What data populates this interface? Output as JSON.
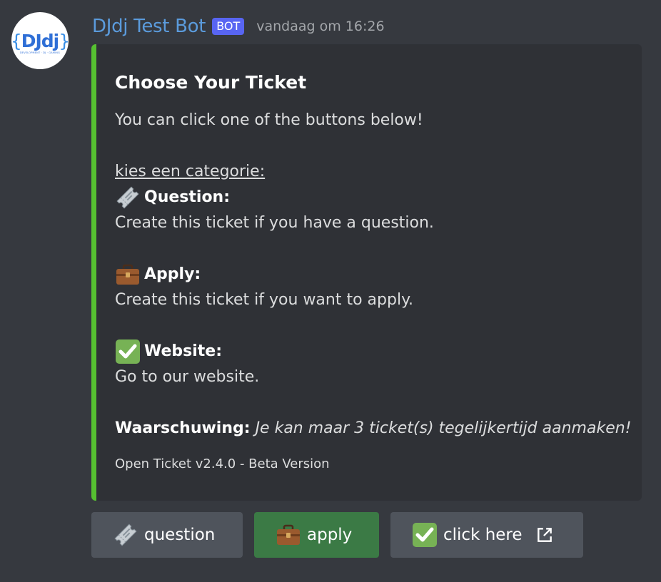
{
  "message": {
    "avatar": {
      "logo_text": "DJdj",
      "logo_tagline": "DEVELOPMENT · DJ · GAMING"
    },
    "author": "DJdj Test Bot",
    "badge": "BOT",
    "timestamp": "vandaag om 16:26"
  },
  "embed": {
    "accent_color": "#56c031",
    "title": "Choose Your Ticket",
    "intro": "You can click one of the buttons below!",
    "category_heading": "kies een categorie:",
    "categories": [
      {
        "icon": "ticket-icon",
        "name": "Question:",
        "description": "Create this ticket if you have a question."
      },
      {
        "icon": "briefcase-icon",
        "name": "Apply:",
        "description": "Create this ticket if you want to apply."
      },
      {
        "icon": "check-mark-icon",
        "name": "Website:",
        "description": "Go to our website."
      }
    ],
    "warning_label": "Waarschuwing:",
    "warning_text": "Je kan maar 3 ticket(s) tegelijkertijd aanmaken!",
    "footer": "Open Ticket v2.4.0 - Beta Version"
  },
  "buttons": [
    {
      "icon": "ticket-icon",
      "label": "question",
      "color": "#4f545c"
    },
    {
      "icon": "briefcase-icon",
      "label": "apply",
      "color": "#3b7a45"
    },
    {
      "icon": "check-mark-icon",
      "label": "click here",
      "trailing_icon": "external-link-icon",
      "color": "#4f545c"
    }
  ]
}
